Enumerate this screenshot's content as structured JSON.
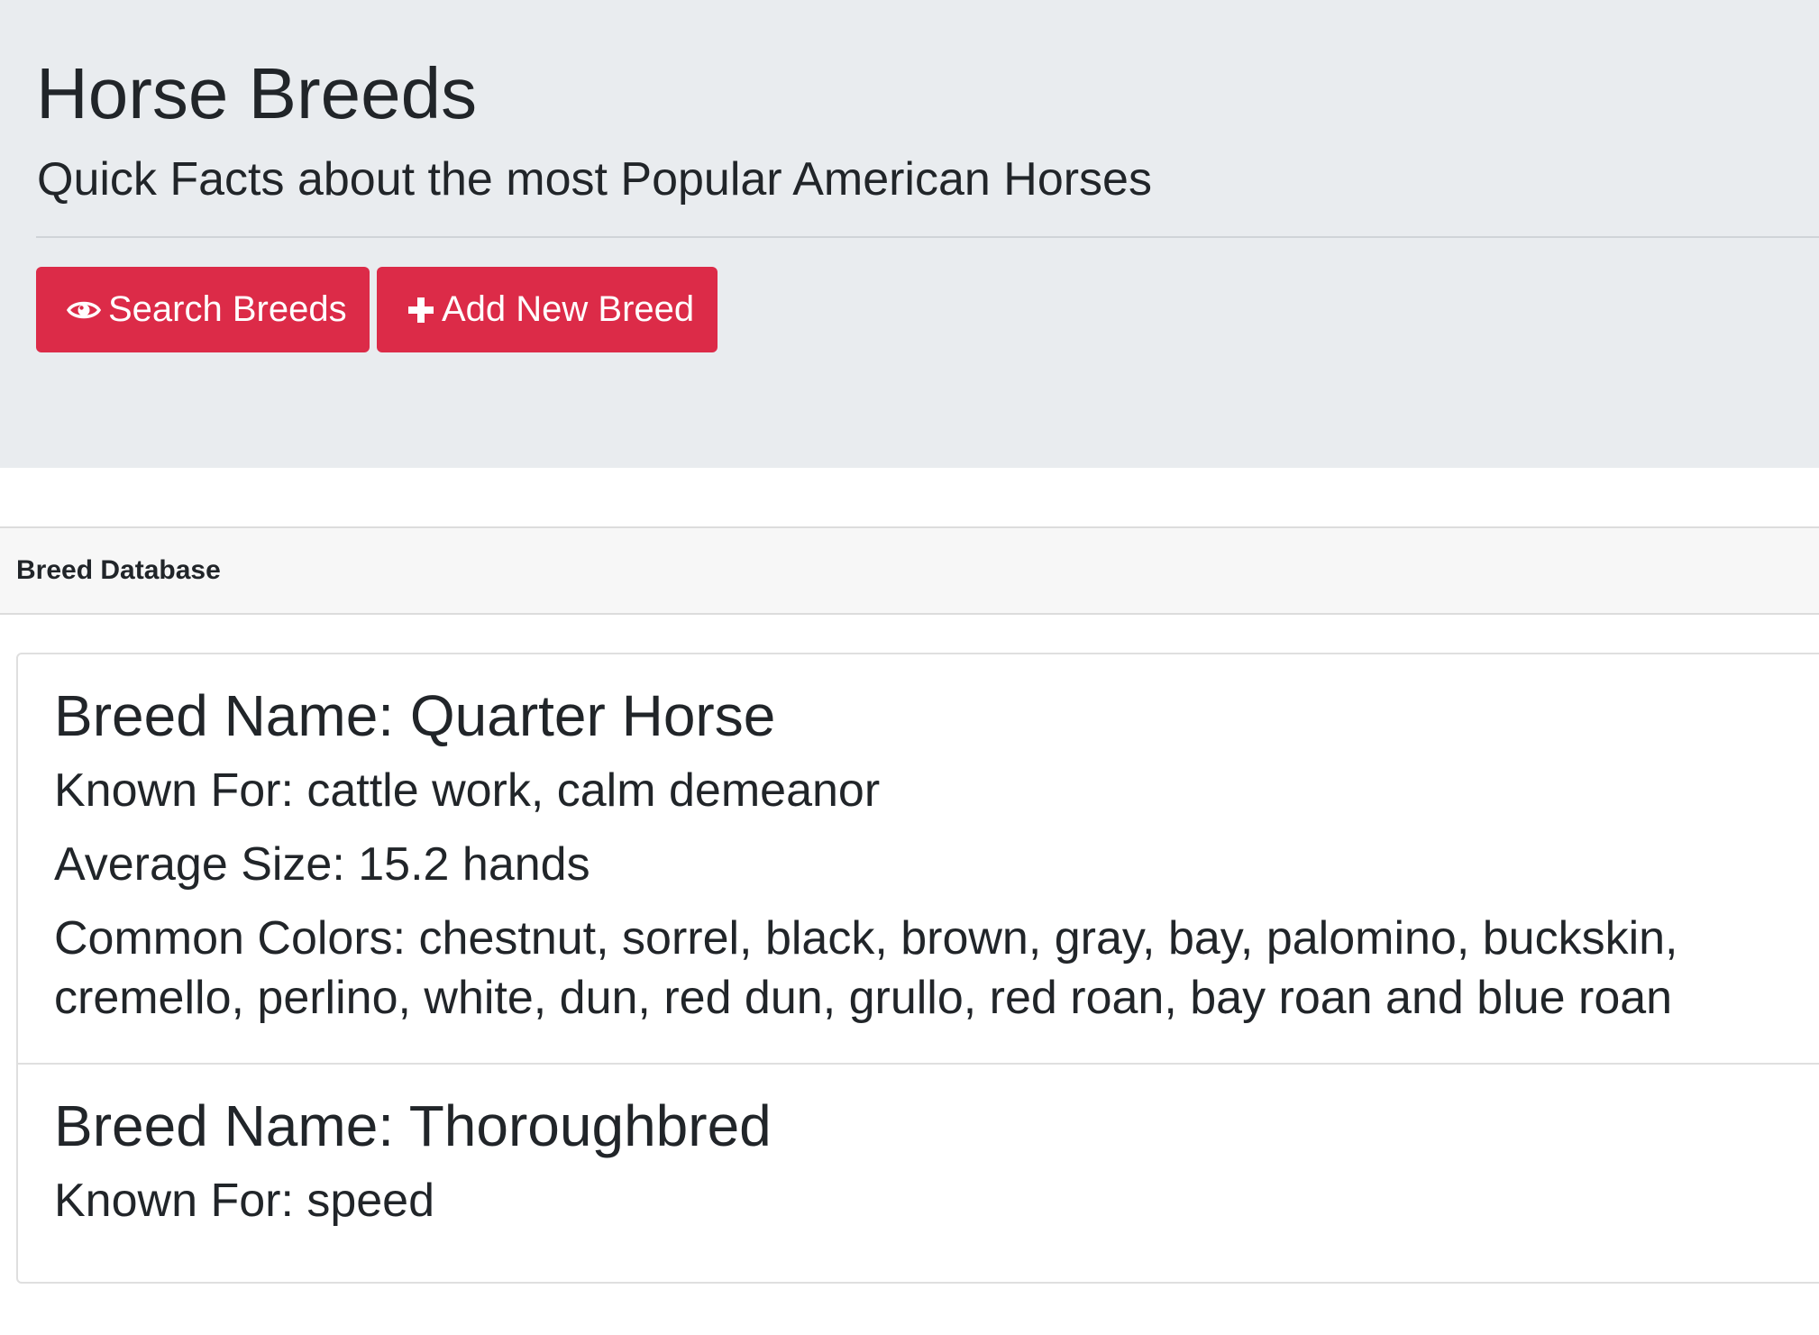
{
  "header": {
    "title": "Horse Breeds",
    "subtitle": "Quick Facts about the most Popular American Horses",
    "buttons": {
      "search_label": "Search Breeds",
      "search_icon": "eye-icon",
      "add_label": "Add New Breed",
      "add_icon": "plus-icon"
    },
    "accent_color": "#dc2b48",
    "background_color": "#e9ecef"
  },
  "database": {
    "header": "Breed Database",
    "breeds": [
      {
        "name": "Breed Name: Quarter Horse",
        "known_for": "Known For: cattle work, calm demeanor",
        "average_size": "Average Size: 15.2 hands",
        "common_colors": "Common Colors: chestnut, sorrel, black, brown, gray, bay, palomino, buckskin, cremello, perlino, white, dun, red dun, grullo, red roan, bay roan and blue roan"
      },
      {
        "name": "Breed Name: Thoroughbred",
        "known_for": "Known For: speed"
      }
    ]
  }
}
